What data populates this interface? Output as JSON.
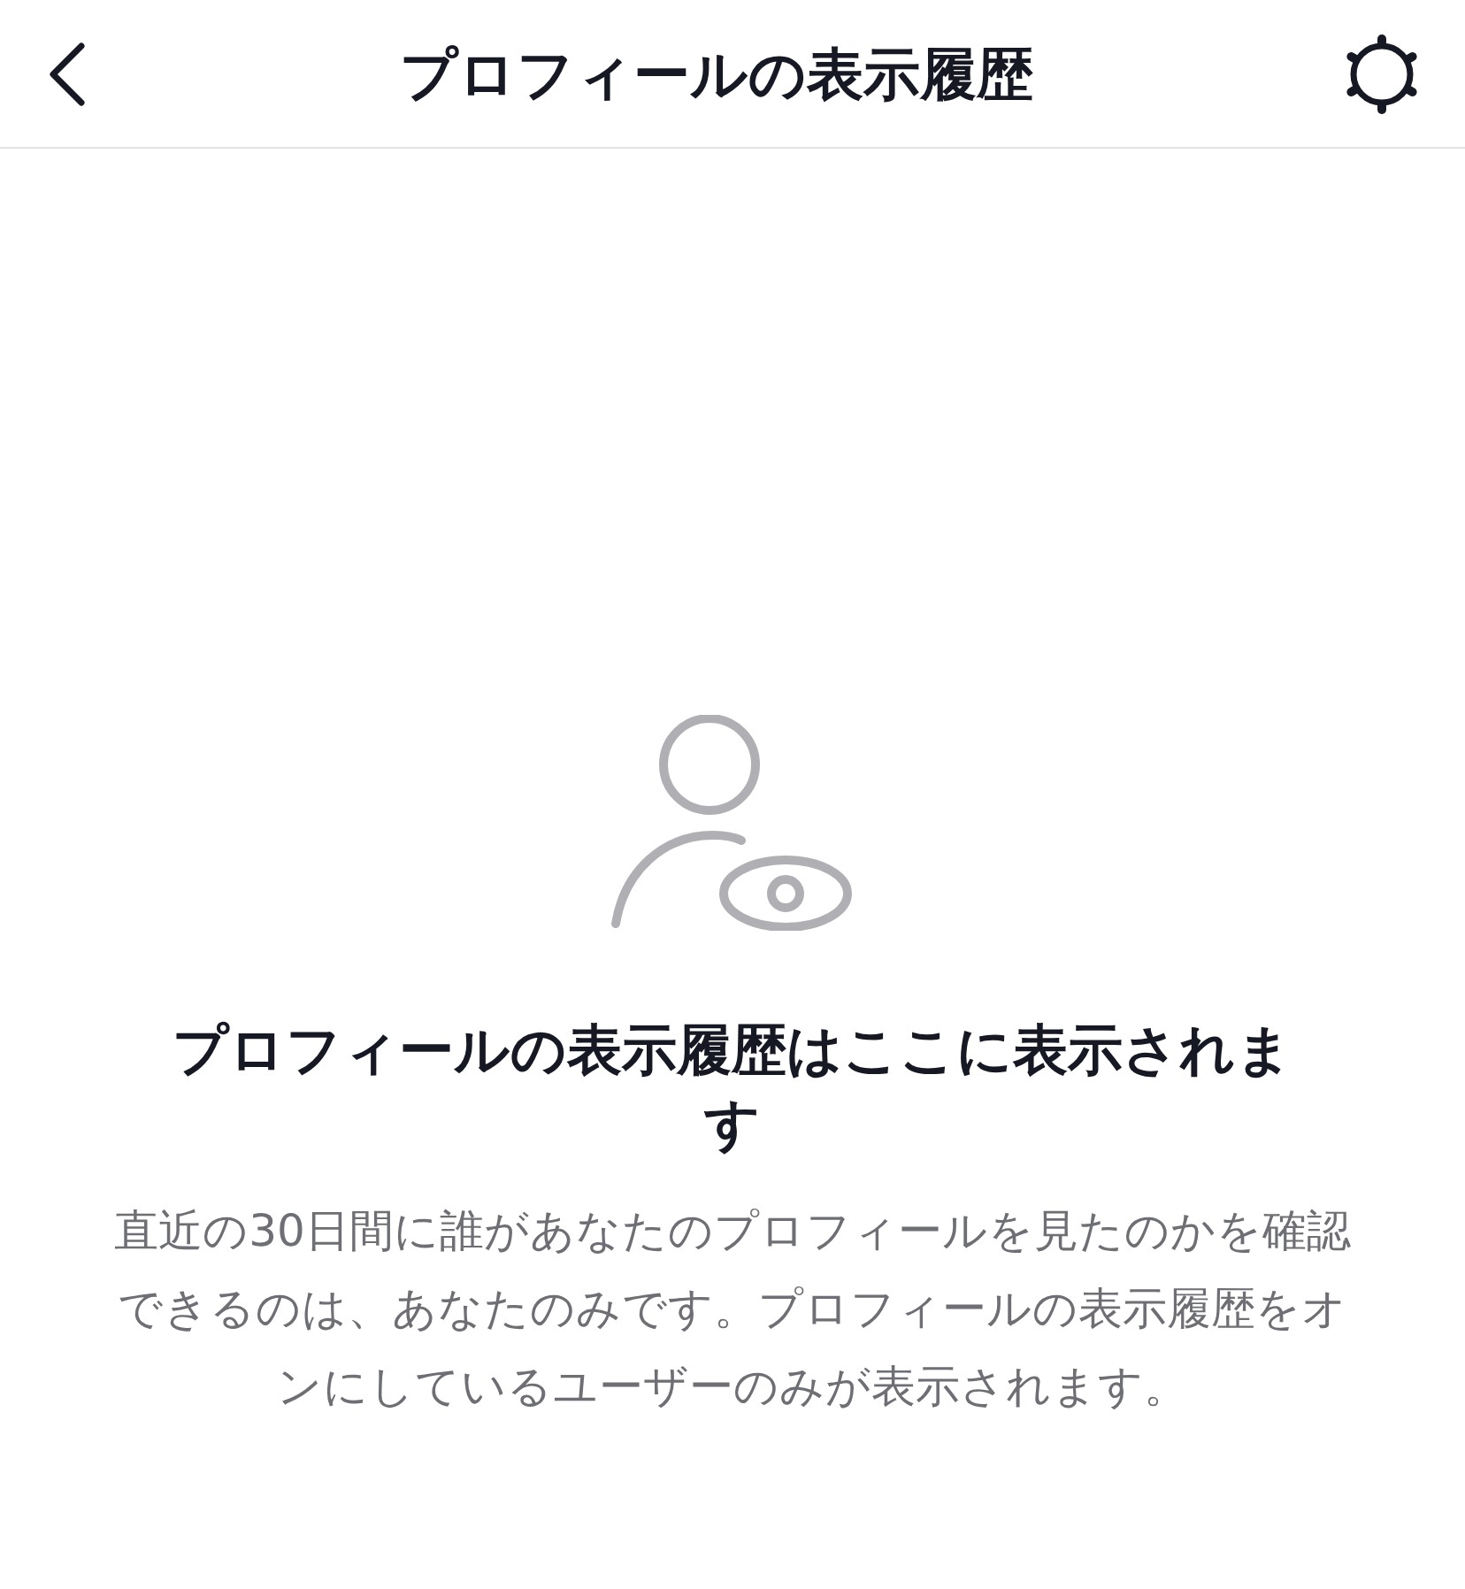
{
  "header": {
    "title": "プロフィールの表示履歴"
  },
  "empty_state": {
    "heading": "プロフィールの表示履歴はここに表示されます",
    "description": "直近の30日間に誰があなたのプロフィールを見たのかを確認できるのは、あなたのみです。プロフィールの表示履歴をオンにしているユーザーのみが表示されます。"
  }
}
